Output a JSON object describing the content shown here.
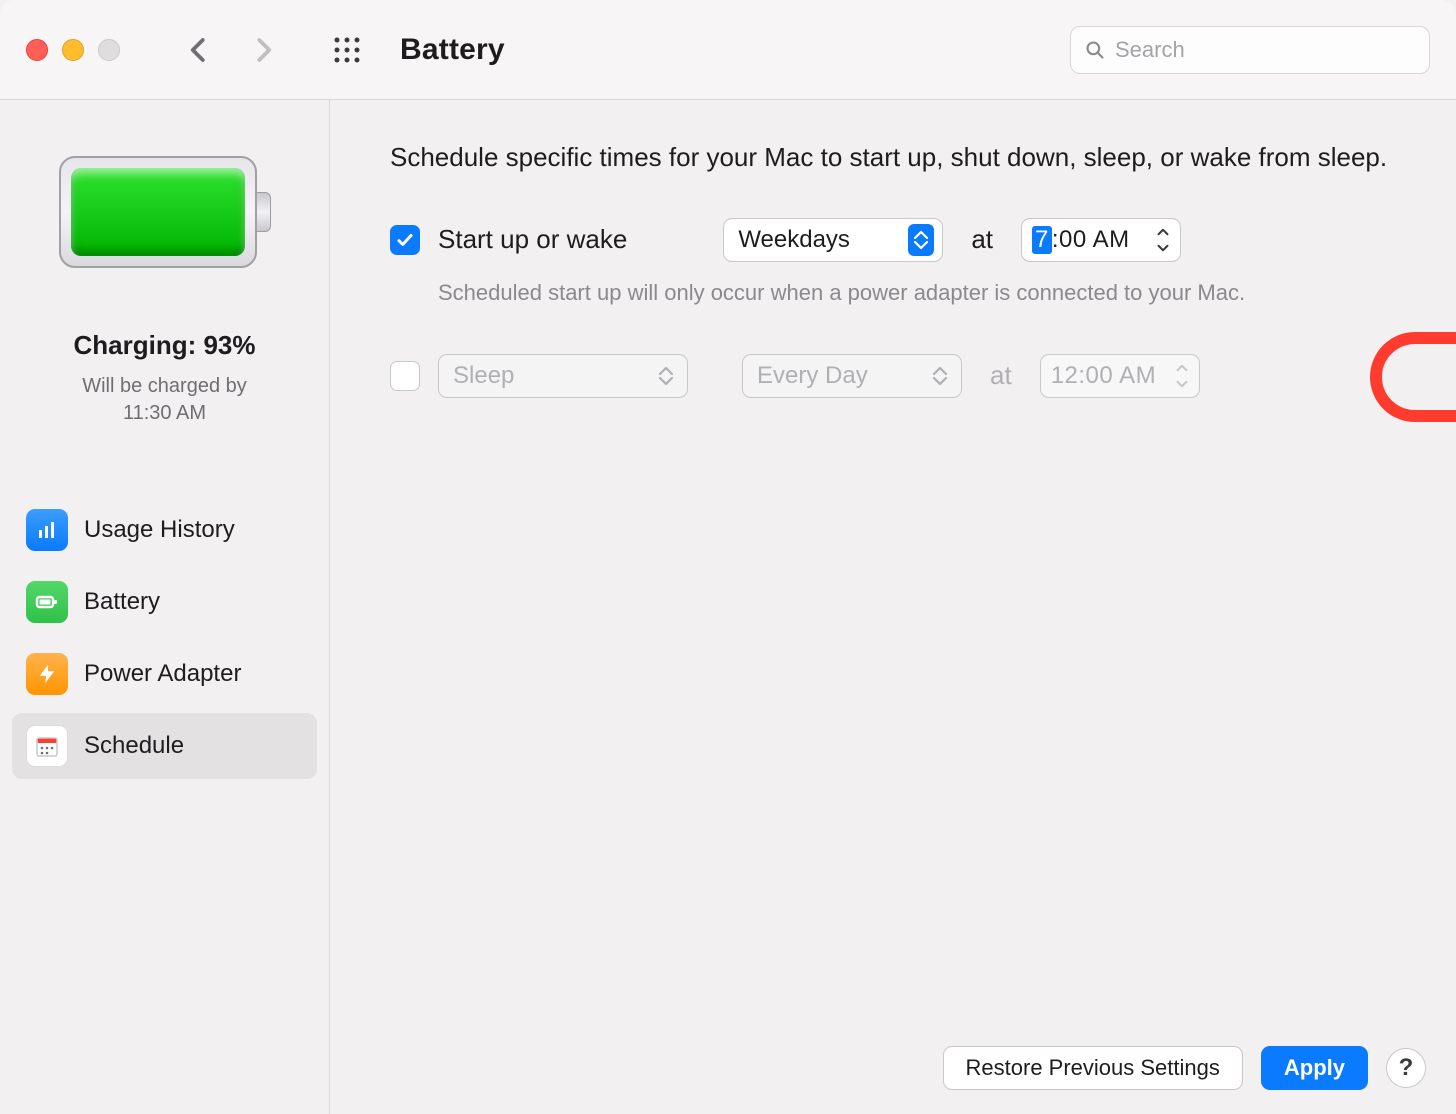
{
  "title": "Battery",
  "search": {
    "placeholder": "Search",
    "value": ""
  },
  "sidebar": {
    "status_line": "Charging: 93%",
    "sub_line1": "Will be charged by",
    "sub_line2": "11:30 AM",
    "items": [
      {
        "label": "Usage History"
      },
      {
        "label": "Battery"
      },
      {
        "label": "Power Adapter"
      },
      {
        "label": "Schedule"
      }
    ]
  },
  "content": {
    "intro": "Schedule specific times for your Mac to start up, shut down, sleep, or wake from sleep.",
    "row1": {
      "checkbox_label": "Start up or wake",
      "day_popup": "Weekdays",
      "at": "at",
      "time_hour": "7",
      "time_rest": ":00 AM",
      "hint": "Scheduled start up will only occur when a power adapter is connected to your Mac."
    },
    "row2": {
      "action_popup": "Sleep",
      "day_popup": "Every Day",
      "at": "at",
      "time": "12:00 AM"
    },
    "footer": {
      "restore": "Restore Previous Settings",
      "apply": "Apply",
      "help": "?"
    }
  }
}
